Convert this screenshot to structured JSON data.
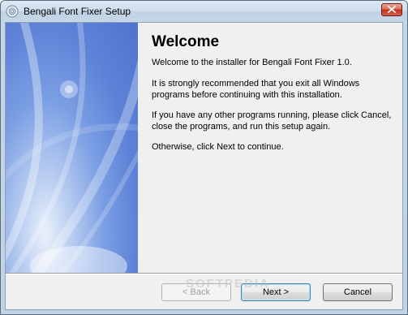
{
  "window": {
    "title": "Bengali Font Fixer Setup",
    "icons": {
      "app": "installer-disc-icon",
      "close": "close-x-icon"
    }
  },
  "welcome": {
    "heading": "Welcome",
    "para1": "Welcome to the installer for Bengali Font Fixer 1.0.",
    "para2": "It is strongly recommended that you exit all Windows programs before continuing with this installation.",
    "para3": "If you have any other programs running, please click Cancel, close the programs, and run this setup again.",
    "para4": "Otherwise, click Next to continue."
  },
  "buttons": {
    "back": "< Back",
    "next": "Next >",
    "cancel": "Cancel"
  },
  "watermark": "SOFTPEDIA",
  "colors": {
    "side_panel": "#5d82d7",
    "titlebar": "#c6d7e8",
    "close_button": "#c0341a"
  }
}
